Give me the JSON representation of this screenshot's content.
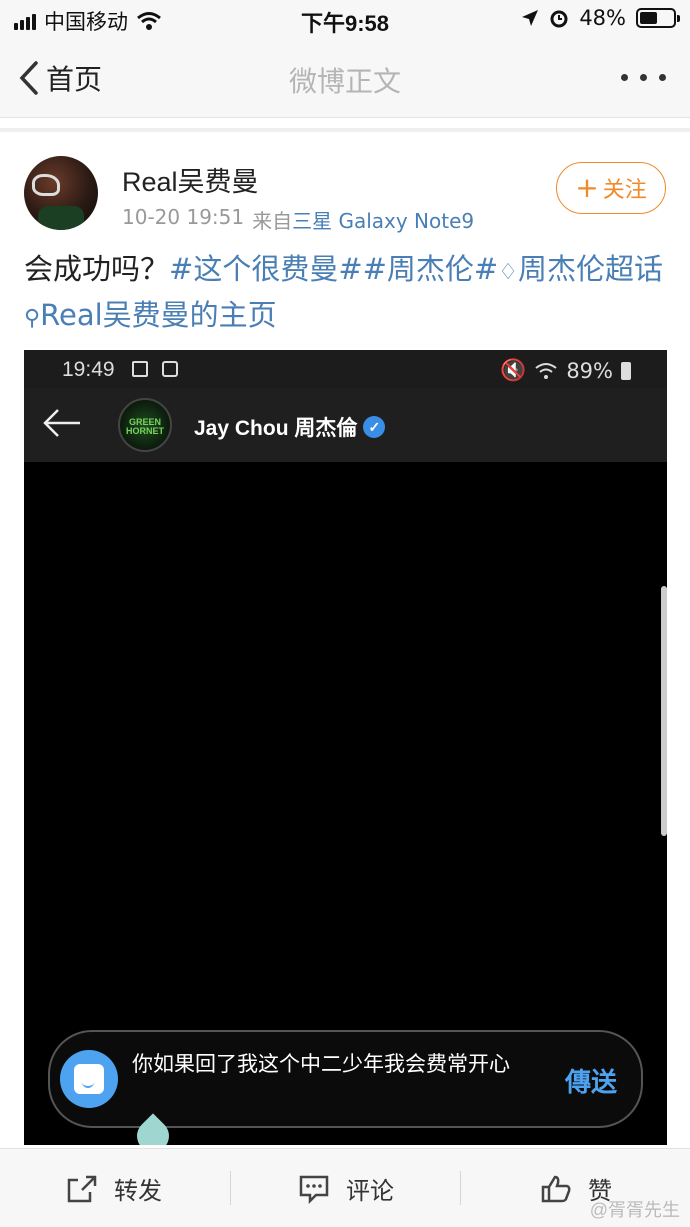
{
  "status_bar": {
    "carrier": "中国移动",
    "time": "下午9:58",
    "battery": "48%",
    "battery_level": 0.48
  },
  "nav": {
    "back_label": "首页",
    "title": "微博正文"
  },
  "post": {
    "username": "Real吴费曼",
    "timestamp": "10-20 19:51",
    "source_prefix": "来自",
    "source_device": "三星 Galaxy Note9",
    "follow_label": "关注",
    "text_plain": "会成功吗？",
    "topic_1": "#这个很费曼#",
    "topic_2": "#周杰伦#",
    "super_topic": "周杰伦超话",
    "profile_link": "Real吴费曼的主页"
  },
  "embedded": {
    "time": "19:49",
    "battery": "89%",
    "chat_name": "Jay Chou 周杰倫",
    "avatar_text": "GREEN HORNET",
    "message": "你如果回了我这个中二少年我会费常开心",
    "send_label": "傳送"
  },
  "bottom_bar": {
    "repost": "转发",
    "comment": "评论",
    "like": "赞"
  },
  "watermark": "@胥胥先生",
  "colors": {
    "link": "#4a7fb5",
    "follow": "#f08a2a",
    "send": "#4ea3f0"
  }
}
